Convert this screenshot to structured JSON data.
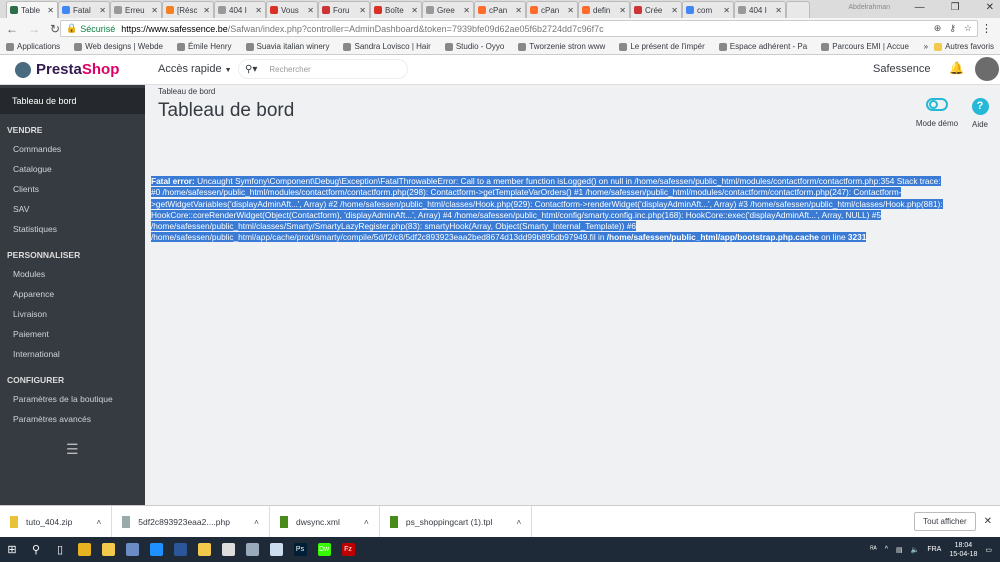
{
  "browser": {
    "tabs": [
      {
        "label": "Table",
        "color": "#2c6e49",
        "active": true
      },
      {
        "label": "Fatal",
        "color": "#4285f4"
      },
      {
        "label": "Erreu",
        "color": "#999"
      },
      {
        "label": "[Résc",
        "color": "#f48024"
      },
      {
        "label": "404 I",
        "color": "#999"
      },
      {
        "label": "Vous",
        "color": "#d93025"
      },
      {
        "label": "Foru",
        "color": "#c33"
      },
      {
        "label": "Boîte",
        "color": "#d93025"
      },
      {
        "label": "Gree",
        "color": "#999"
      },
      {
        "label": "cPan",
        "color": "#ff6c2c"
      },
      {
        "label": "cPan",
        "color": "#ff6c2c"
      },
      {
        "label": "defin",
        "color": "#ff6c2c"
      },
      {
        "label": "Crée",
        "color": "#c33"
      },
      {
        "label": "com",
        "color": "#4285f4"
      },
      {
        "label": "404 I",
        "color": "#999"
      }
    ],
    "profile": "Abdelrahman",
    "secure_label": "Sécurisé",
    "url_domain": "https://www.safessence.be",
    "url_path": "/Safwan/index.php?controller=AdminDashboard&token=7939bfe09d62ae05f6b2724dd7c96f7c",
    "bookmarks": [
      "Applications",
      "Web designs | Webde",
      "Émile Henry",
      "Suavia italian winery",
      "Sandra Lovisco | Hair",
      "Studio - Oyyo",
      "Tworzenie stron www",
      "Le présent de l'impér",
      "Espace adhérent - Pa",
      "Parcours EMI | Accue"
    ],
    "other_bookmarks": "Autres favoris"
  },
  "header": {
    "logo": "PrestaShop",
    "logo_a": "Presta",
    "logo_b": "Shop",
    "quick_access": "Accès rapide",
    "search_placeholder": "Rechercher",
    "shop_name": "Safessence"
  },
  "sidebar": {
    "active": "Tableau de bord",
    "sections": [
      {
        "title": "VENDRE",
        "items": [
          "Commandes",
          "Catalogue",
          "Clients",
          "SAV",
          "Statistiques"
        ]
      },
      {
        "title": "PERSONNALISER",
        "items": [
          "Modules",
          "Apparence",
          "Livraison",
          "Paiement",
          "International"
        ]
      },
      {
        "title": "CONFIGURER",
        "items": [
          "Paramètres de la boutique",
          "Paramètres avancés"
        ]
      }
    ]
  },
  "page": {
    "breadcrumb": "Tableau de bord",
    "title": "Tableau de bord",
    "demo_label": "Mode démo",
    "help_label": "Aide"
  },
  "error": {
    "label": "Fatal error:",
    "lines": [
      "Uncaught Symfony\\Component\\Debug\\Exception\\FatalThrowableError: Call to a member function isLogged() on null in /home/safessen/public_html/modules/contactform/contactform.php:354 Stack trace:",
      "#0 /home/safessen/public_html/modules/contactform/contactform.php(298): Contactform->getTemplateVarOrders() #1 /home/safessen/public_html/modules/contactform/contactform.php(247): Contactform-",
      ">getWidgetVariables('displayAdminAft...', Array) #2 /home/safessen/public_html/classes/Hook.php(929): Contactform->renderWidget('displayAdminAft...', Array) #3 /home/safessen/public_html/classes/Hook.php(881):",
      "HookCore::coreRenderWidget(Object(Contactform), 'displayAdminAft...', Array) #4 /home/safessen/public_html/config/smarty.config.inc.php(168): HookCore::exec('displayAdminAft...', Array, NULL) #5",
      "/home/safessen/public_html/classes/Smarty/SmartyLazyRegister.php(83): smartyHook(Array, Object(Smarty_Internal_Template)) #6",
      "/home/safessen/public_html/app/cache/prod/smarty/compile/5d/f2/c8/5df2c893923eaa2bed8674d13dd99b895db97949.fil in"
    ],
    "file": "/home/safessen/public_html/app/bootstrap.php.cache",
    "on_line": "on line",
    "line_no": "3231"
  },
  "downloads": {
    "items": [
      {
        "name": "tuto_404.zip",
        "color": "#e8c23a"
      },
      {
        "name": "5df2c893923eaa2....php",
        "color": "#9aa"
      },
      {
        "name": "dwsync.xml",
        "color": "#4a8a1a"
      },
      {
        "name": "ps_shoppingcart (1).tpl",
        "color": "#4a8a1a"
      }
    ],
    "show_all": "Tout afficher"
  },
  "taskbar": {
    "lang": "FRA",
    "time": "18:04",
    "date": "15-04-18",
    "apps": [
      {
        "name": "chrome",
        "color": "#e8b321"
      },
      {
        "name": "explorer",
        "color": "#f2c94c"
      },
      {
        "name": "network",
        "color": "#6a8cc7"
      },
      {
        "name": "edge",
        "color": "#1e90ff"
      },
      {
        "name": "word",
        "color": "#2b579a"
      },
      {
        "name": "paint",
        "color": "#f2c94c"
      },
      {
        "name": "mail",
        "color": "#ddd"
      },
      {
        "name": "notes",
        "color": "#9ab"
      },
      {
        "name": "notepad",
        "color": "#cde"
      },
      {
        "name": "photoshop",
        "color": "#001e36",
        "label": "Ps"
      },
      {
        "name": "dreamweaver",
        "color": "#35fa00",
        "label": "Dw"
      },
      {
        "name": "filezilla",
        "color": "#bf0000",
        "label": "Fz"
      }
    ]
  }
}
